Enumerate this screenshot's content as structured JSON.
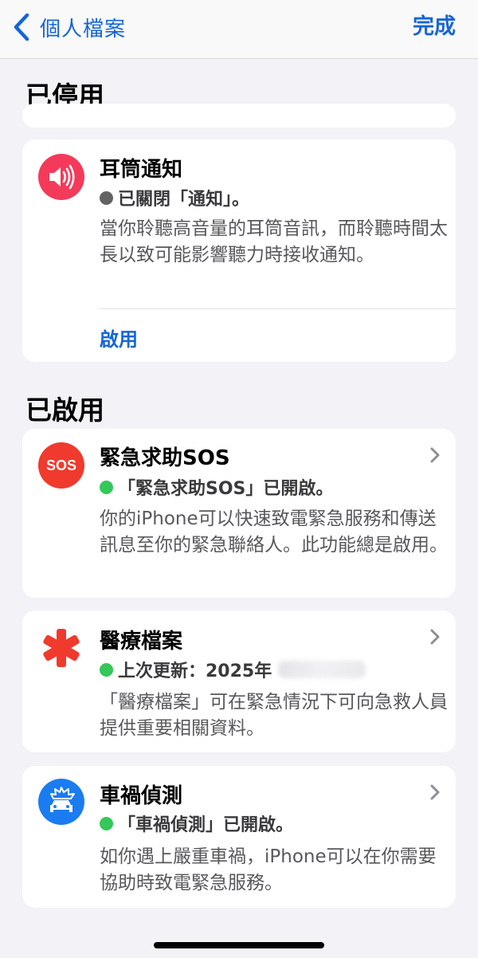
{
  "nav": {
    "back_label": "個人檔案",
    "done_label": "完成"
  },
  "sections": {
    "disabled_title": "已停用",
    "enabled_title": "已啟用"
  },
  "headphone_card": {
    "title": "耳筒通知",
    "status": "已關閉「通知」。",
    "description": "當你聆聽高音量的耳筒音訊，而聆聽時間太長以致可能影響聽力時接收通知。",
    "action_label": "啟用",
    "icon": "speaker-wave-icon"
  },
  "sos_card": {
    "title": "緊急求助SOS",
    "status": "「緊急求助SOS」已開啟。",
    "description": "你的iPhone可以快速致電緊急服務和傳送訊息至你的緊急聯絡人。此功能總是啟用。",
    "icon_text": "SOS"
  },
  "medical_card": {
    "title": "醫療檔案",
    "status": "上次更新：2025年",
    "description": "「醫療檔案」可在緊急情況下可向急救人員提供重要相關資料。",
    "icon": "medical-asterisk-icon"
  },
  "crash_card": {
    "title": "車禍偵測",
    "status": "「車禍偵測」已開啟。",
    "description": "如你遇上嚴重車禍，iPhone可以在你需要協助時致電緊急服務。",
    "icon": "car-crash-icon"
  },
  "colors": {
    "accent_blue": "#1565d8",
    "status_on": "#34c759",
    "status_off": "#636366",
    "sos_red": "#f03a2e",
    "headphone_pink": "#f43a5a",
    "crash_blue": "#1a7cf0"
  }
}
